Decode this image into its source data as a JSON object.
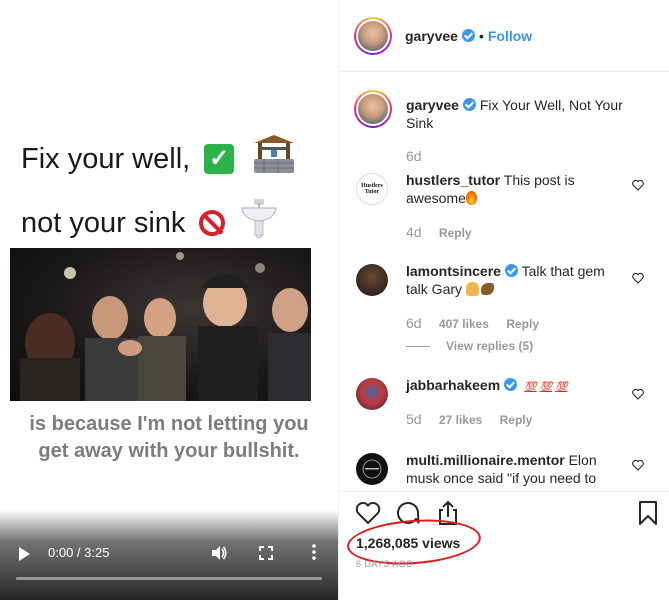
{
  "video": {
    "headline_line1": "Fix your well,",
    "headline_line2": "not your sink",
    "caption_line1": "is because I'm not letting you",
    "caption_line2": "get away with your bullshit.",
    "timecode": "0:00 / 3:25",
    "progress_fraction": 0.0
  },
  "post": {
    "username": "garyvee",
    "follow_label": "Follow",
    "caption_text": "Fix Your Well, Not Your Sink",
    "caption_age": "6d",
    "views": "1,268,085 views",
    "date": "6 DAYS AGO"
  },
  "comments": [
    {
      "username": "hustlers_tutor",
      "avatar_text": "Hustlers Tutor",
      "text": "This post is awesome",
      "age": "4d",
      "likes": "",
      "reply": "Reply",
      "verified": false
    },
    {
      "username": "lamontsincere",
      "text": "Talk that gem talk Gary",
      "age": "6d",
      "likes": "407 likes",
      "reply": "Reply",
      "view_replies": "View replies (5)",
      "verified": true
    },
    {
      "username": "jabbarhakeem",
      "text": "",
      "emoji": [
        "💯",
        "💯",
        "💯"
      ],
      "age": "5d",
      "likes": "27 likes",
      "reply": "Reply",
      "verified": true
    },
    {
      "username": "multi.millionaire.mentor",
      "text": "Elon musk once said \"if you need to",
      "age": "",
      "likes": "",
      "reply": "",
      "verified": false
    }
  ],
  "colors": {
    "link_blue": "#3897f0",
    "verified_blue": "#3897f0",
    "annotation_red": "#e3171b",
    "muted_text": "#999999"
  },
  "icons": [
    "play-icon",
    "volume-icon",
    "fullscreen-icon",
    "more-vert-icon",
    "heart-icon",
    "comment-icon",
    "share-icon",
    "bookmark-icon",
    "verified-icon"
  ]
}
